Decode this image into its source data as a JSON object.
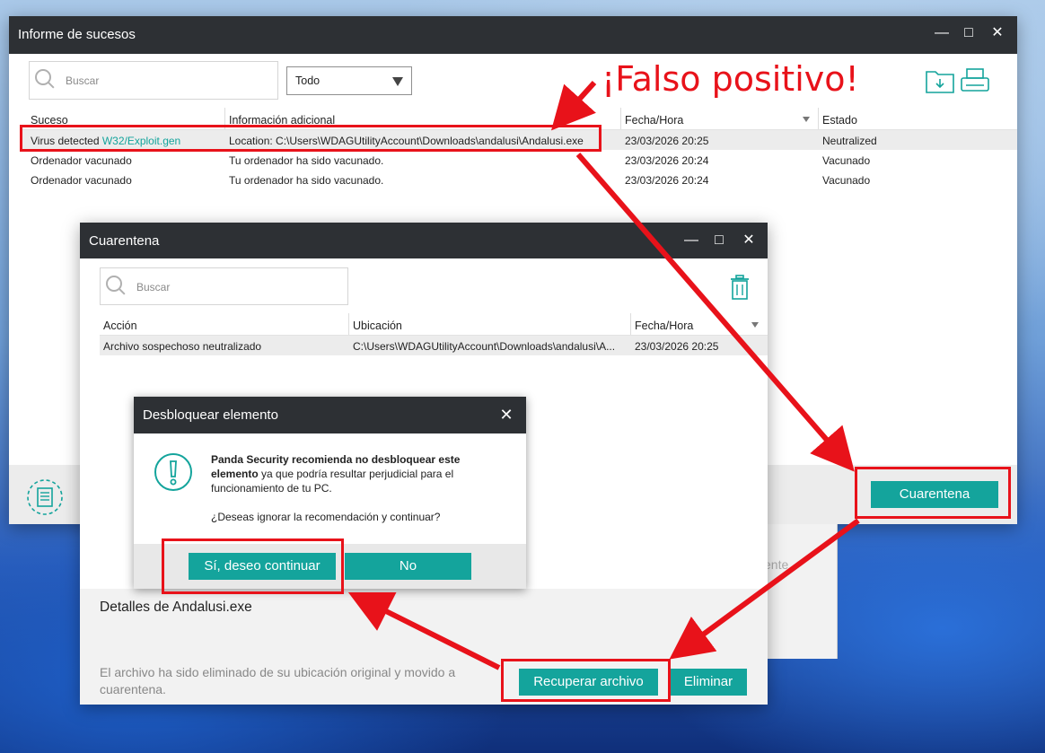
{
  "annotation": {
    "text": "¡Falso positivo!",
    "color": "#e8121a"
  },
  "events_window": {
    "title": "Informe de sucesos",
    "search_placeholder": "Buscar",
    "filter_value": "Todo",
    "columns": [
      "Suceso",
      "Información adicional",
      "Fecha/Hora",
      "Estado"
    ],
    "rows": [
      {
        "event_prefix": "Virus detected ",
        "event_link": "W32/Exploit.gen",
        "info": "Location: C:\\Users\\WDAGUtilityAccount\\Downloads\\andalusi\\Andalusi.exe",
        "date": "23/03/2026 20:25",
        "status": "Neutralized"
      },
      {
        "event_prefix": "Ordenador vacunado",
        "event_link": "",
        "info": "Tu ordenador ha sido vacunado.",
        "date": "23/03/2026 20:24",
        "status": "Vacunado"
      },
      {
        "event_prefix": "Ordenador vacunado",
        "event_link": "",
        "info": "Tu ordenador ha sido vacunado.",
        "date": "23/03/2026 20:24",
        "status": "Vacunado"
      }
    ],
    "quarantine_button": "Cuarentena"
  },
  "quarantine_window": {
    "title": "Cuarentena",
    "search_placeholder": "Buscar",
    "columns": [
      "Acción",
      "Ubicación",
      "Fecha/Hora"
    ],
    "row": {
      "action": "Archivo sospechoso neutralizado",
      "location": "C:\\Users\\WDAGUtilityAccount\\Downloads\\andalusi\\A...",
      "date": "23/03/2026 20:25"
    },
    "details_title": "Detalles de Andalusi.exe",
    "details_text": "El archivo ha sido eliminado de su ubicación original y movido a cuarentena.",
    "recover_button": "Recuperar archivo",
    "delete_button": "Eliminar",
    "partial_text": "ente"
  },
  "unlock_dialog": {
    "title": "Desbloquear elemento",
    "message_bold": "Panda Security recomienda no desbloquear este elemento",
    "message_rest": " ya que podría resultar perjudicial para el funcionamiento de tu PC.",
    "question": "¿Deseas ignorar la recomendación y continuar?",
    "yes_button": "Sí, deseo continuar",
    "no_button": "No"
  },
  "colors": {
    "teal": "#14a49c",
    "titlebar": "#2d3034",
    "red": "#e8121a"
  }
}
